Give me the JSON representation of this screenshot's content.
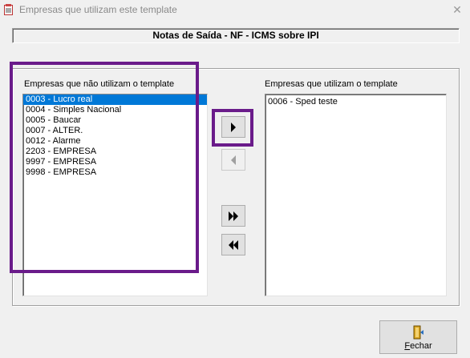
{
  "window": {
    "title": "Empresas que utilizam este template",
    "close_glyph": "✕"
  },
  "header": {
    "title": "Notas de Saída - NF - ICMS sobre IPI"
  },
  "left_list": {
    "label": "Empresas que não utilizam o template",
    "items": [
      "0003 - Lucro real",
      "0004 - Simples Nacional",
      "0005 - Baucar",
      "0007 - ALTER.",
      "0012 - Alarme",
      "2203 - EMPRESA",
      "9997 - EMPRESA",
      "9998 - EMPRESA"
    ],
    "selected_index": 0
  },
  "right_list": {
    "label": "Empresas que utilizam o template",
    "items": [
      "0006 - Sped teste"
    ]
  },
  "buttons": {
    "move_right_icon": "arrow-right-icon",
    "move_left_icon": "arrow-left-icon",
    "move_all_right_icon": "double-arrow-right-icon",
    "move_all_left_icon": "double-arrow-left-icon",
    "close_first_letter": "F",
    "close_rest": "echar"
  },
  "colors": {
    "selection": "#0078d7",
    "highlight": "#6a1b8a"
  }
}
